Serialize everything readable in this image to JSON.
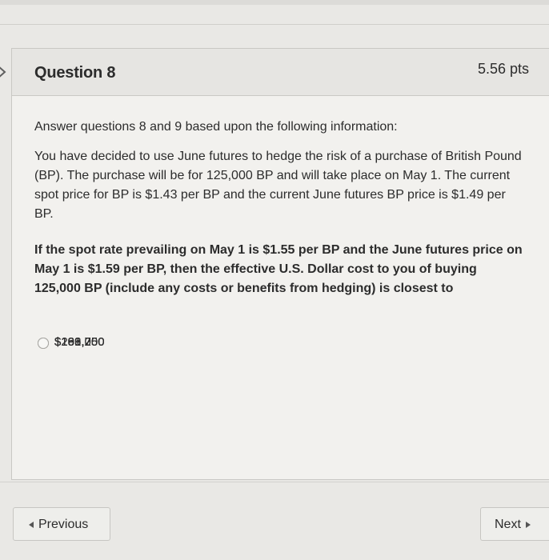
{
  "question": {
    "title": "Question 8",
    "points": "5.56 pts",
    "intro": "Answer questions 8 and 9 based upon the following information:",
    "scenario": "You have decided to use June futures to hedge the risk of a purchase of British Pound (BP). The purchase will be for 125,000 BP and will take place on May 1. The current spot price for BP is $1.43 per BP and the current June futures BP price is $1.49 per BP.",
    "prompt": "If the spot rate prevailing on May 1 is $1.55 per BP and the June futures price on May 1 is $1.59 per BP, then the effective U.S. Dollar cost to you of buying 125,000 BP (include any costs or benefits from hedging) is closest to",
    "answers": [
      {
        "label": "$169,000"
      },
      {
        "label": "$181,250"
      },
      {
        "label": "$193,750"
      },
      {
        "label": "$206,250"
      }
    ]
  },
  "navigation": {
    "previous_label": "Previous",
    "next_label": "Next",
    "left_arrow_icon": "left-arrow-icon",
    "right_arrow_icon": "right-arrow-icon"
  }
}
